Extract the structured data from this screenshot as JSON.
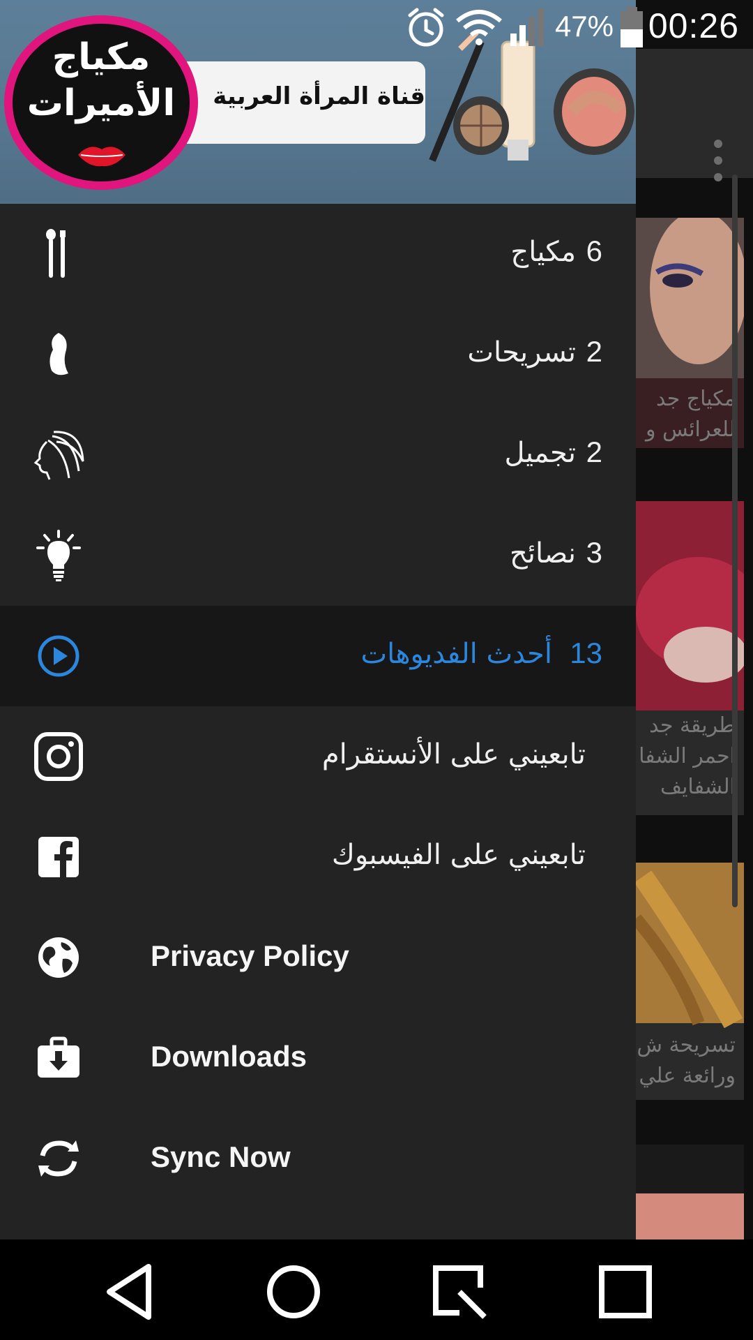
{
  "status_bar": {
    "battery_percent": "47%",
    "time": "00:26",
    "icons": [
      "alarm-icon",
      "wifi-icon",
      "signal-icon",
      "battery-icon"
    ]
  },
  "drawer": {
    "header": {
      "logo_line1": "مكياج",
      "logo_line2": "الأميرات",
      "channel_name": "قناة المرأة العربية"
    },
    "items": [
      {
        "label": "مكياج",
        "count": "6",
        "icon": "makeup-brush-icon"
      },
      {
        "label": "تسريحات",
        "count": "2",
        "icon": "hair-icon"
      },
      {
        "label": "تجميل",
        "count": "2",
        "icon": "woman-face-icon"
      },
      {
        "label": "نصائح",
        "count": "3",
        "icon": "lightbulb-icon"
      },
      {
        "label": "أحدث الفديوهات",
        "count": "13",
        "icon": "play-icon",
        "selected": true
      },
      {
        "label": "تابعيني على الأنستقرام",
        "icon": "instagram-icon"
      },
      {
        "label": "تابعيني على الفيسبوك",
        "icon": "facebook-icon"
      },
      {
        "label": "Privacy Policy",
        "icon": "globe-icon"
      },
      {
        "label": "Downloads",
        "icon": "download-icon"
      },
      {
        "label": "Sync Now",
        "icon": "sync-icon"
      }
    ]
  },
  "background": {
    "cards": [
      {
        "title_line1": "مكياج جد",
        "title_line2": "للعرائس و"
      },
      {
        "title_line1": "طريقة جد",
        "title_line2": "احمر الشفا",
        "title_line3": "الشفايف"
      },
      {
        "title_line1": "تسريحة ش",
        "title_line2": "ورائعة علي"
      }
    ]
  },
  "colors": {
    "accent": "#2b86dc",
    "drawer_bg": "#232323",
    "selected_bg": "#171717",
    "logo_ring": "#e0157e"
  }
}
